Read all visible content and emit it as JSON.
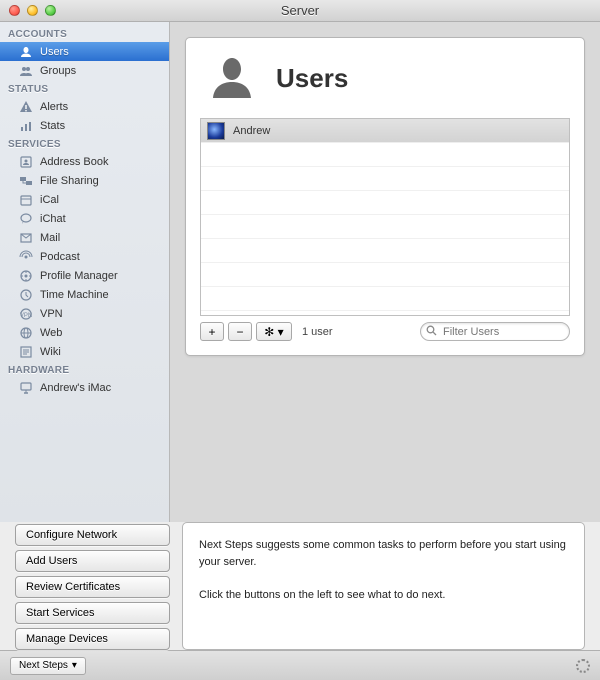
{
  "window": {
    "title": "Server"
  },
  "sidebar": {
    "sections": [
      {
        "header": "ACCOUNTS",
        "items": [
          {
            "label": "Users",
            "icon": "user-icon",
            "selected": true
          },
          {
            "label": "Groups",
            "icon": "group-icon",
            "selected": false
          }
        ]
      },
      {
        "header": "STATUS",
        "items": [
          {
            "label": "Alerts",
            "icon": "alert-icon",
            "selected": false
          },
          {
            "label": "Stats",
            "icon": "stats-icon",
            "selected": false
          }
        ]
      },
      {
        "header": "SERVICES",
        "items": [
          {
            "label": "Address Book",
            "icon": "addressbook-icon",
            "selected": false
          },
          {
            "label": "File Sharing",
            "icon": "filesharing-icon",
            "selected": false
          },
          {
            "label": "iCal",
            "icon": "ical-icon",
            "selected": false
          },
          {
            "label": "iChat",
            "icon": "ichat-icon",
            "selected": false
          },
          {
            "label": "Mail",
            "icon": "mail-icon",
            "selected": false
          },
          {
            "label": "Podcast",
            "icon": "podcast-icon",
            "selected": false
          },
          {
            "label": "Profile Manager",
            "icon": "profilemanager-icon",
            "selected": false
          },
          {
            "label": "Time Machine",
            "icon": "timemachine-icon",
            "selected": false
          },
          {
            "label": "VPN",
            "icon": "vpn-icon",
            "selected": false
          },
          {
            "label": "Web",
            "icon": "web-icon",
            "selected": false
          },
          {
            "label": "Wiki",
            "icon": "wiki-icon",
            "selected": false
          }
        ]
      },
      {
        "header": "HARDWARE",
        "items": [
          {
            "label": "Andrew's iMac",
            "icon": "imac-icon",
            "selected": false
          }
        ]
      }
    ]
  },
  "main": {
    "heading": "Users",
    "users": [
      {
        "name": "Andrew"
      }
    ],
    "toolbar": {
      "add": "+",
      "remove": "−",
      "gear": "✻ ▾",
      "count": "1 user",
      "search_placeholder": "Filter Users"
    }
  },
  "buttons": [
    "Configure Network",
    "Add Users",
    "Review Certificates",
    "Start Services",
    "Manage Devices"
  ],
  "nextsteps": {
    "line1": "Next Steps suggests some common tasks to perform before you start using your server.",
    "line2": "Click the buttons on the left to see what to do next."
  },
  "footer": {
    "button": "Next Steps",
    "arrow": "▾"
  }
}
